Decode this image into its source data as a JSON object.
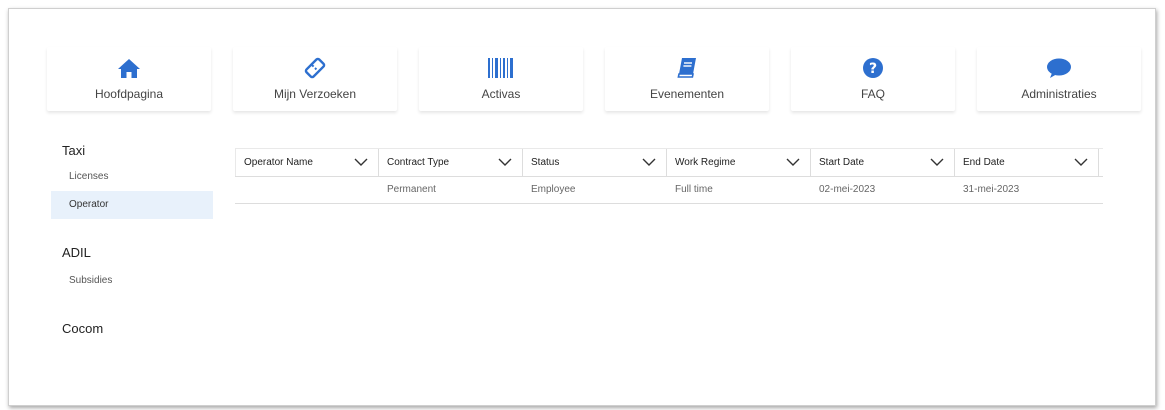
{
  "colors": {
    "accent": "#2d6fcf",
    "active_bg": "#e8f1fb"
  },
  "nav": [
    {
      "label": "Hoofdpagina",
      "icon": "home-icon"
    },
    {
      "label": "Mijn Verzoeken",
      "icon": "tag-icon"
    },
    {
      "label": "Activas",
      "icon": "barcode-icon"
    },
    {
      "label": "Evenementen",
      "icon": "book-icon"
    },
    {
      "label": "FAQ",
      "icon": "question-circle-icon"
    },
    {
      "label": "Administraties",
      "icon": "chat-bubble-icon"
    }
  ],
  "sidebar": {
    "groups": [
      {
        "title": "Taxi",
        "items": [
          "Licenses",
          "Operator"
        ],
        "active": "Operator"
      },
      {
        "title": "ADIL",
        "items": [
          "Subsidies"
        ]
      },
      {
        "title": "Cocom",
        "items": []
      }
    ]
  },
  "table": {
    "columns": [
      "Operator Name",
      "Contract Type",
      "Status",
      "Work Regime",
      "Start Date",
      "End Date"
    ],
    "rows": [
      [
        "",
        "Permanent",
        "Employee",
        "Full time",
        "02-mei-2023",
        "31-mei-2023"
      ]
    ]
  }
}
